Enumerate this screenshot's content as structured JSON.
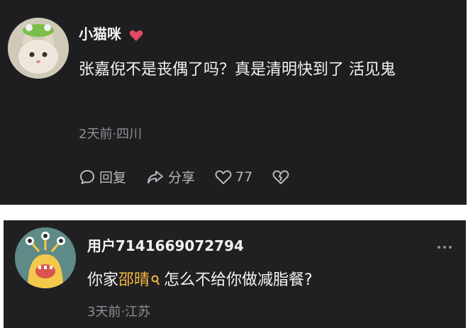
{
  "comments": [
    {
      "username": "小猫咪",
      "username_badge": "heart-icon",
      "text": "张嘉倪不是丧偶了吗？真是清明快到了 活见鬼",
      "meta": "2天前·四川",
      "actions": {
        "reply_label": "回复",
        "share_label": "分享",
        "like_count": "77"
      }
    },
    {
      "username": "用户7141669072794",
      "text_before": "你家",
      "mention": "邵晴",
      "text_after": "怎么不给你做减脂餐?",
      "meta": "3天前·江苏"
    }
  ],
  "colors": {
    "background": "#1e1e20",
    "mention": "#f3b83f",
    "meta": "#8f8f93",
    "heart": "#e24a62"
  }
}
